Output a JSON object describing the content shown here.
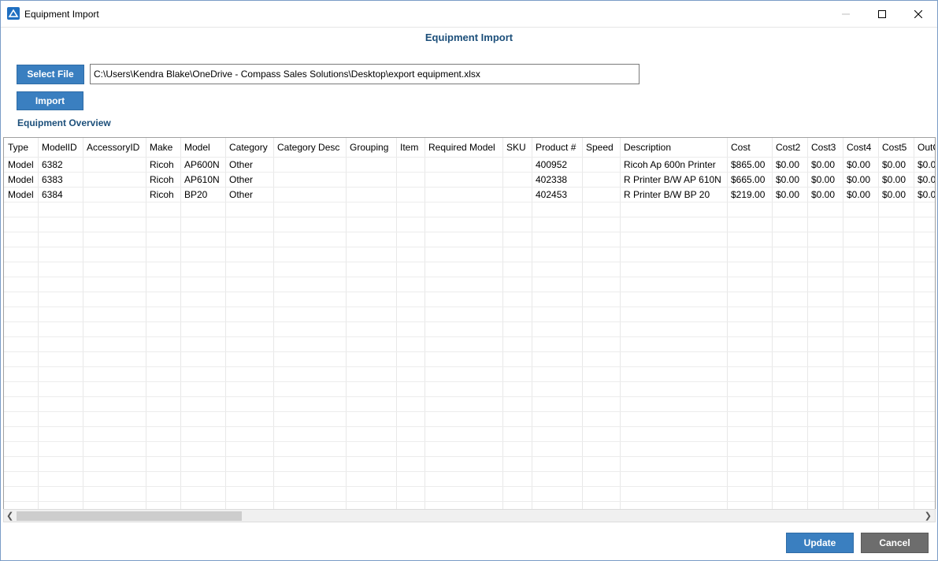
{
  "window": {
    "title": "Equipment Import",
    "minimize_icon": "minimize-icon",
    "maximize_icon": "maximize-icon",
    "close_icon": "close-icon"
  },
  "header": {
    "title": "Equipment Import"
  },
  "file": {
    "select_label": "Select File",
    "path": "C:\\Users\\Kendra Blake\\OneDrive - Compass Sales Solutions\\Desktop\\export equipment.xlsx",
    "import_label": "Import"
  },
  "overview": {
    "label": "Equipment Overview"
  },
  "table": {
    "columns": [
      "Type",
      "ModelID",
      "AccessoryID",
      "Make",
      "Model",
      "Category",
      "Category Desc",
      "Grouping",
      "Item",
      "Required Model",
      "SKU",
      "Product #",
      "Speed",
      "Description",
      "Cost",
      "Cost2",
      "Cost3",
      "Cost4",
      "Cost5",
      "OutC"
    ],
    "rows": [
      [
        "Model",
        "6382",
        "",
        "Ricoh",
        "AP600N",
        "Other",
        "",
        "",
        "",
        "",
        "",
        "400952",
        "",
        "Ricoh Ap 600n Printer",
        "$865.00",
        "$0.00",
        "$0.00",
        "$0.00",
        "$0.00",
        "$0.0"
      ],
      [
        "Model",
        "6383",
        "",
        "Ricoh",
        "AP610N",
        "Other",
        "",
        "",
        "",
        "",
        "",
        "402338",
        "",
        "R Printer B/W AP 610N",
        "$665.00",
        "$0.00",
        "$0.00",
        "$0.00",
        "$0.00",
        "$0.0"
      ],
      [
        "Model",
        "6384",
        "",
        "Ricoh",
        "BP20",
        "Other",
        "",
        "",
        "",
        "",
        "",
        "402453",
        "",
        "R Printer B/W BP 20",
        "$219.00",
        "$0.00",
        "$0.00",
        "$0.00",
        "$0.00",
        "$0.0"
      ]
    ]
  },
  "scrollbar": {
    "left_icon": "scroll-left-icon",
    "right_icon": "scroll-right-icon"
  },
  "footer": {
    "update_label": "Update",
    "cancel_label": "Cancel"
  },
  "colors": {
    "accent": "#3a7fc0",
    "heading": "#1c4f7a",
    "cancel": "#6d6d6d"
  }
}
